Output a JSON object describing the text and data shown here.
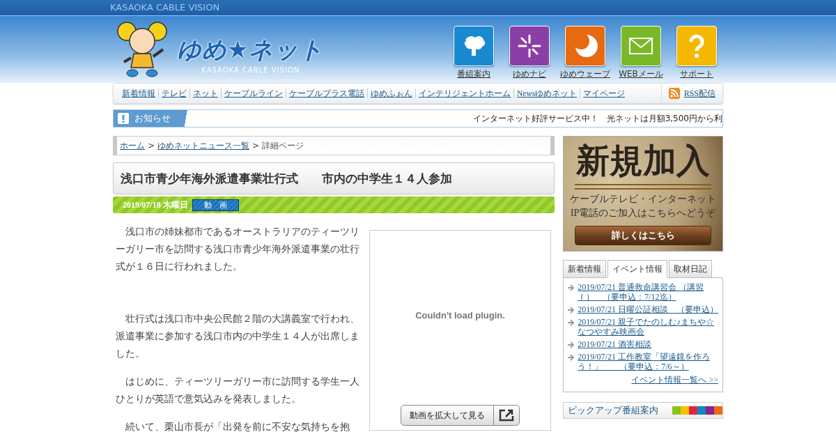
{
  "top_bar": {
    "title": "KASAOKA CABLE VISION"
  },
  "logo": {
    "name": "ゆめ★ネット",
    "subtitle": "KASAOKA CABLE VISION"
  },
  "service_icons": [
    {
      "kind": "tv",
      "label": "番組案内",
      "color": "#1a8ad0"
    },
    {
      "kind": "navi",
      "label": "ゆめナビ",
      "color": "#8a3fa6"
    },
    {
      "kind": "wave",
      "label": "ゆめウェーブ",
      "color": "#e86a10"
    },
    {
      "kind": "mail",
      "label": "WEBメール",
      "color": "#7ab828"
    },
    {
      "kind": "support",
      "label": "サポート",
      "color": "#f5b800"
    }
  ],
  "nav": {
    "items": [
      "新着情報",
      "テレビ",
      "ネット",
      "ケーブルライン",
      "ケーブルプラス電話",
      "ゆめふぉん",
      "インテリジェントホーム",
      "Newsゆめネット",
      "マイページ"
    ],
    "rss": "RSS配信"
  },
  "notice": {
    "label": "お知らせ",
    "text": "インターネット好評サービス中！　光ネットは月額3,500円から利"
  },
  "breadcrumb": [
    {
      "kind": "link",
      "label": "ホーム"
    },
    {
      "kind": "separator",
      "label": ">"
    },
    {
      "kind": "link",
      "label": "ゆめネットニュース一覧"
    },
    {
      "kind": "separator",
      "label": ">"
    },
    {
      "kind": "current",
      "label": "詳細ページ"
    }
  ],
  "article": {
    "title": "浅口市青少年海外派遣事業壮行式　　市内の中学生１４人参加",
    "date": "2019/07/18 木曜日",
    "video_badge": "動　画",
    "paragraphs": [
      "浅口市の姉妹都市であるオーストラリアのティーツリーガリー市を訪問する浅口市青少年海外派遣事業の壮行式が１６日に行われました。",
      "壮行式は浅口市中央公民館２階の大講義室で行われ、派遣事業に参加する浅口市内の中学生１４人が出席しました。",
      "はじめに、ティーツリーガリー市に訪問する学生一人ひとりが英語で意気込みを発表しました。",
      "続いて、栗山市長が「出発を前に不安な気持ちを抱"
    ],
    "video": {
      "message": "Couldn't load plugin.",
      "button": "動画を拡大して見る"
    }
  },
  "banner": {
    "headline": "新規加入",
    "line_1": "ケーブルテレビ・インターネット",
    "line_2": "IP電話のご加入はこちらへどうぞ",
    "button": "詳しくはこちら"
  },
  "tabs": [
    {
      "label": "新着情報",
      "selected": false
    },
    {
      "label": "イベント情報",
      "selected": true
    },
    {
      "label": "取材日記",
      "selected": false
    }
  ],
  "events": [
    "2019/07/21 普通救命講習会 （講習Ｉ）　（要申込：7/12迄）",
    "2019/07/21 日曜公証相談　（要申込）",
    "2019/07/21 親子でたのしむ♪まちや☆なつやすみ映画会",
    "2019/07/21 酒害相談",
    "2019/07/21 工作教室「望遠鏡を作ろう！」　　（要申込：7/6～）"
  ],
  "events_more": "イベント情報一覧へ >>",
  "pickup": {
    "title": "ピックアップ番組案内",
    "color_tabs": [
      {
        "color": "#8cc11f"
      },
      {
        "color": "#f8c200"
      },
      {
        "color": "#e0263c"
      },
      {
        "color": "#0c86c4"
      },
      {
        "color": "#8e1f8c"
      },
      {
        "color": "#f06a10"
      }
    ]
  }
}
